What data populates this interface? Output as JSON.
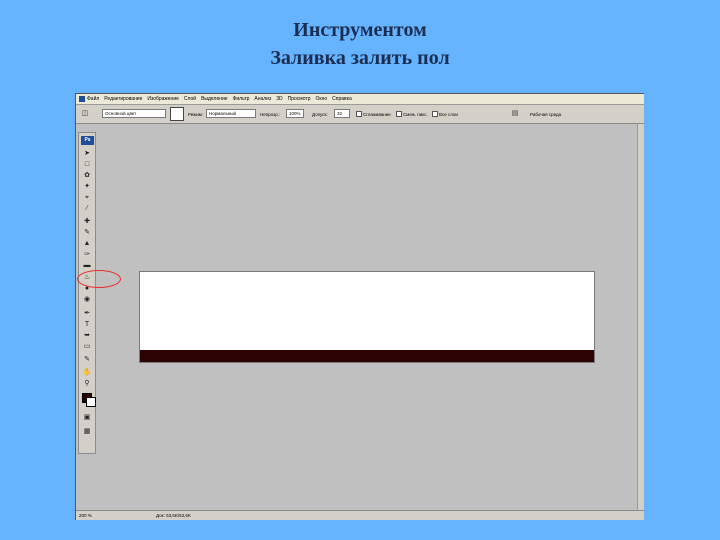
{
  "slide": {
    "title_line1": "Инструментом",
    "title_line2": "Заливка залить пол"
  },
  "app": {
    "name_badge": "Ps",
    "menu": [
      "Файл",
      "Редактирование",
      "Изображение",
      "Слой",
      "Выделение",
      "Фильтр",
      "Анализ",
      "3D",
      "Просмотр",
      "Окно",
      "Справка"
    ],
    "options": {
      "fill_source": "Основной цвет",
      "mode_label": "Режим:",
      "mode_value": "Нормальный",
      "opacity_label": "Непрозр.:",
      "opacity_value": "100%",
      "tolerance_label": "Допуск:",
      "tolerance_value": "32",
      "antialias_label": "Сглаживание",
      "contiguous_label": "Смеж. пикс.",
      "all_layers_label": "Все слои",
      "workspace_label": "Рабочая среда"
    },
    "status": {
      "zoom": "200 %",
      "doc_size": "Док: 53,6K/53,6K"
    },
    "colors": {
      "slide_bg": "#66B3FF",
      "title": "#1A2E52",
      "workspace_bg": "#C0C0C0",
      "floor_fill": "#2B0303",
      "highlight": "#E8302A"
    },
    "tools": [
      "move-tool-icon",
      "marquee-tool-icon",
      "lasso-tool-icon",
      "magic-wand-tool-icon",
      "crop-tool-icon",
      "eyedropper-tool-icon",
      "healing-brush-tool-icon",
      "brush-tool-icon",
      "clone-stamp-tool-icon",
      "history-brush-tool-icon",
      "eraser-tool-icon",
      "paint-bucket-tool-icon",
      "blur-tool-icon",
      "dodge-tool-icon",
      "pen-tool-icon",
      "type-tool-icon",
      "path-selection-tool-icon",
      "shape-tool-icon",
      "notes-tool-icon",
      "hand-tool-icon",
      "zoom-tool-icon"
    ]
  }
}
